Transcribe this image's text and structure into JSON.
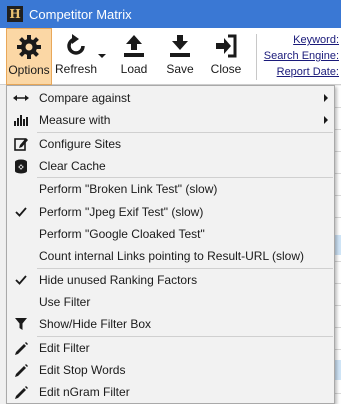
{
  "window": {
    "title": "Competitor Matrix"
  },
  "toolbar": {
    "buttons": [
      {
        "label": "Options",
        "icon": "gear-icon"
      },
      {
        "label": "Refresh",
        "icon": "refresh-icon"
      },
      {
        "label": "Load",
        "icon": "upload-icon"
      },
      {
        "label": "Save",
        "icon": "download-icon"
      },
      {
        "label": "Close",
        "icon": "exit-icon"
      }
    ],
    "fields": {
      "keyword": "Keyword:",
      "search_engine": "Search Engine:",
      "report_date": "Report Date:"
    }
  },
  "menu": {
    "items": [
      {
        "label": "Compare against",
        "icon": "double-arrow-icon",
        "submenu": true
      },
      {
        "label": "Measure with",
        "icon": "bar-chart-icon",
        "submenu": true
      },
      {
        "label": "Configure Sites",
        "icon": "edit-box-icon"
      },
      {
        "label": "Clear Cache",
        "icon": "database-clear-icon"
      },
      {
        "label": "Perform \"Broken Link Test\" (slow)",
        "icon": ""
      },
      {
        "label": "Perform \"Jpeg Exif Test\" (slow)",
        "icon": "checkmark-icon",
        "checked": true
      },
      {
        "label": "Perform \"Google Cloaked Test\"",
        "icon": ""
      },
      {
        "label": "Count internal Links pointing to Result-URL (slow)",
        "icon": ""
      },
      {
        "label": "Hide unused Ranking Factors",
        "icon": "checkmark-icon",
        "checked": true
      },
      {
        "label": "Use Filter",
        "icon": ""
      },
      {
        "label": "Show/Hide Filter Box",
        "icon": "filter-icon"
      },
      {
        "label": "Edit Filter",
        "icon": "pencil-icon"
      },
      {
        "label": "Edit Stop Words",
        "icon": "pencil-icon"
      },
      {
        "label": "Edit nGram Filter",
        "icon": "pencil-icon"
      }
    ]
  },
  "colors": {
    "titlebar": "#3a78d4",
    "active_button": "#fbd7a5",
    "menu_background": "#f2f2f2"
  }
}
